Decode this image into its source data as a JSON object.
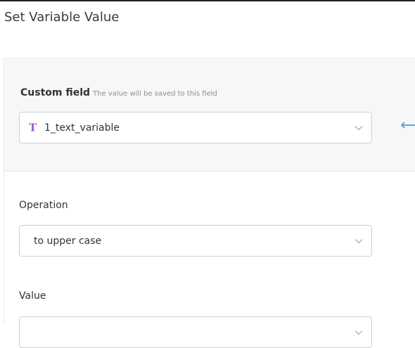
{
  "header": {
    "title": "Set Variable Value"
  },
  "custom_field": {
    "label": "Custom field",
    "hint": "The value will be saved to this field",
    "selected_value": "1_text_variable",
    "type_icon": "text-type-icon",
    "type_icon_glyph": "T",
    "type_icon_color": "#9b59d8"
  },
  "operation": {
    "label": "Operation",
    "selected_value": "to upper case"
  },
  "value": {
    "label": "Value"
  },
  "colors": {
    "arrow": "#5aa7e0"
  }
}
